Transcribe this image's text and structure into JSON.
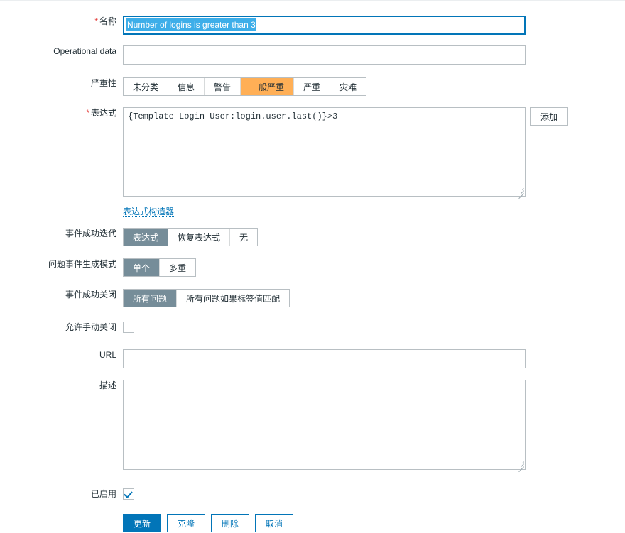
{
  "form": {
    "name": {
      "label": "名称",
      "required": true,
      "value": "Number of logins is greater than 3",
      "selected": true
    },
    "operational_data": {
      "label": "Operational data",
      "required": false,
      "value": "",
      "placeholder": ""
    },
    "severity": {
      "label": "严重性",
      "required": false,
      "options": [
        "未分类",
        "信息",
        "警告",
        "一般严重",
        "严重",
        "灾难"
      ],
      "selected_index": 3,
      "selected_color": "#ffaf56"
    },
    "expression": {
      "label": "表达式",
      "required": true,
      "value": "{Template Login User:login.user.last()}>3",
      "add_button": "添加",
      "constructor_link": "表达式构造器"
    },
    "ok_event_generation": {
      "label": "事件成功迭代",
      "options": [
        "表达式",
        "恢复表达式",
        "无"
      ],
      "selected_index": 0
    },
    "problem_event_generation_mode": {
      "label": "问题事件生成模式",
      "options": [
        "单个",
        "多重"
      ],
      "selected_index": 0
    },
    "ok_event_closes": {
      "label": "事件成功关闭",
      "options": [
        "所有问题",
        "所有问题如果标签值匹配"
      ],
      "selected_index": 0
    },
    "allow_manual_close": {
      "label": "允许手动关闭",
      "checked": false
    },
    "url": {
      "label": "URL",
      "value": "",
      "placeholder": ""
    },
    "description": {
      "label": "描述",
      "value": "",
      "placeholder": ""
    },
    "enabled": {
      "label": "已启用",
      "checked": true
    }
  },
  "footer": {
    "buttons": [
      {
        "label": "更新",
        "style": "primary"
      },
      {
        "label": "克隆",
        "style": "outline"
      },
      {
        "label": "删除",
        "style": "outline"
      },
      {
        "label": "取消",
        "style": "outline"
      }
    ]
  },
  "colors": {
    "accent": "#0275b8",
    "required": "#e33734",
    "selected_radio": "#768d99",
    "severity_average": "#ffaf56",
    "selection_highlight": "#3daee9",
    "border": "#b8bfc3"
  }
}
